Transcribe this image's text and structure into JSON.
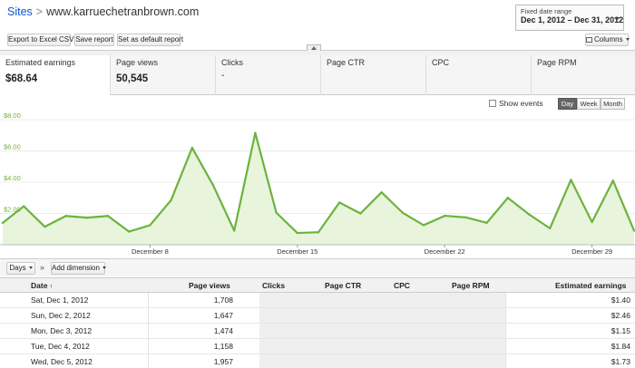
{
  "header": {
    "sites_link": "Sites",
    "separator": ">",
    "site_name": "www.karruechetranbrown.com"
  },
  "date_range": {
    "label": "Fixed date range",
    "value": "Dec 1, 2012 – Dec 31, 2012"
  },
  "toolbar": {
    "export_label": "Export to Excel CSV",
    "save_label": "Save report",
    "default_label": "Set as default report",
    "columns_label": "Columns"
  },
  "metrics": [
    {
      "label": "Estimated earnings",
      "value": "$68.64"
    },
    {
      "label": "Page views",
      "value": "50,545"
    },
    {
      "label": "Clicks",
      "value": "-"
    },
    {
      "label": "Page CTR",
      "value": ""
    },
    {
      "label": "CPC",
      "value": ""
    },
    {
      "label": "Page RPM",
      "value": ""
    }
  ],
  "chart_controls": {
    "show_events_label": "Show events",
    "day_label": "Day",
    "week_label": "Week",
    "month_label": "Month",
    "active": "Day"
  },
  "chart_data": {
    "type": "area",
    "title": "",
    "xlabel": "",
    "ylabel": "",
    "x": [
      "Dec 1",
      "Dec 2",
      "Dec 3",
      "Dec 4",
      "Dec 5",
      "Dec 6",
      "Dec 7",
      "Dec 8",
      "Dec 9",
      "Dec 10",
      "Dec 11",
      "Dec 12",
      "Dec 13",
      "Dec 14",
      "Dec 15",
      "Dec 16",
      "Dec 17",
      "Dec 18",
      "Dec 19",
      "Dec 20",
      "Dec 21",
      "Dec 22",
      "Dec 23",
      "Dec 24",
      "Dec 25",
      "Dec 26",
      "Dec 27",
      "Dec 28",
      "Dec 29",
      "Dec 30",
      "Dec 31"
    ],
    "series": [
      {
        "values": [
          1.4,
          2.46,
          1.15,
          1.84,
          1.73,
          1.84,
          0.84,
          1.25,
          2.85,
          6.2,
          3.8,
          0.9,
          7.15,
          2.05,
          0.75,
          0.8,
          2.7,
          2.0,
          3.35,
          2.05,
          1.25,
          1.85,
          1.75,
          1.4,
          3.0,
          1.95,
          1.05,
          4.15,
          1.45,
          4.1,
          0.9
        ]
      }
    ],
    "y_ticks": [
      "$2.00",
      "$4.00",
      "$6.00",
      "$8.00"
    ],
    "ylim": [
      0,
      8
    ],
    "x_ticks": [
      "December 8",
      "December 15",
      "December 22",
      "December 29"
    ],
    "line_color": "#6cb33e",
    "fill_color": "#e8f4dc",
    "grid": true
  },
  "table_controls": {
    "days_label": "Days",
    "more_label": "»",
    "add_dimension_label": "Add dimension"
  },
  "table": {
    "headers": {
      "date": "Date",
      "sort_indicator": "↑",
      "page_views": "Page views",
      "clicks": "Clicks",
      "page_ctr": "Page CTR",
      "cpc": "CPC",
      "page_rpm": "Page RPM",
      "estimated_earnings": "Estimated earnings"
    },
    "rows": [
      {
        "date": "Sat, Dec 1, 2012",
        "page_views": "1,708",
        "earnings": "$1.40"
      },
      {
        "date": "Sun, Dec 2, 2012",
        "page_views": "1,647",
        "earnings": "$2.46"
      },
      {
        "date": "Mon, Dec 3, 2012",
        "page_views": "1,474",
        "earnings": "$1.15"
      },
      {
        "date": "Tue, Dec 4, 2012",
        "page_views": "1,158",
        "earnings": "$1.84"
      },
      {
        "date": "Wed, Dec 5, 2012",
        "page_views": "1,957",
        "earnings": "$1.73"
      }
    ]
  }
}
